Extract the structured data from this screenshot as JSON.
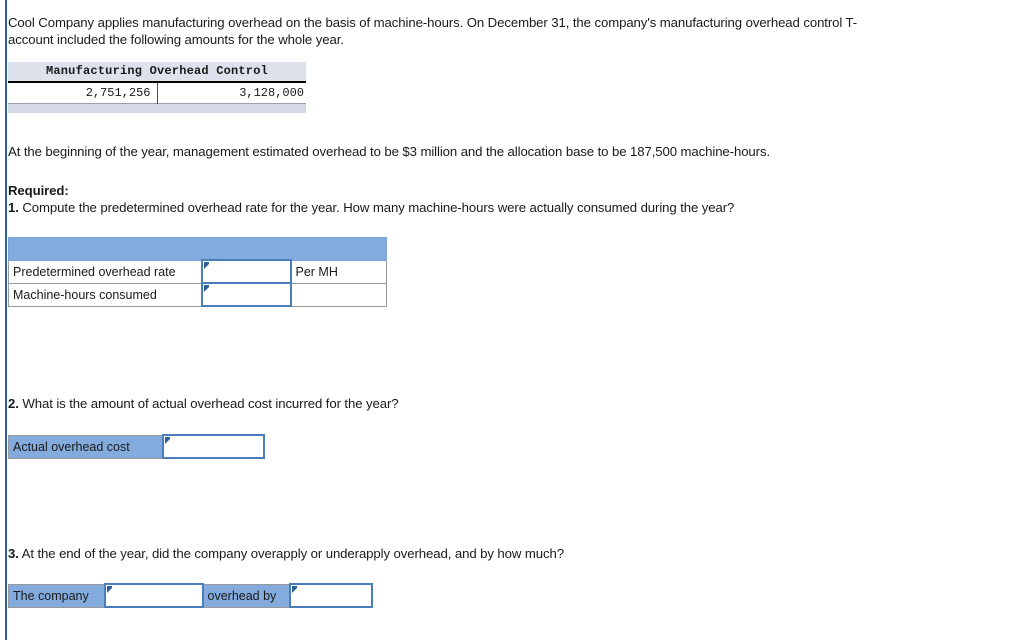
{
  "colors": {
    "left_rule": "#2f5fa8",
    "header_band": "#83abdd",
    "label_blue": "#83abdd",
    "input_border": "#4a7ebb",
    "input_marker": "#2d5f9e",
    "taccount_header_bg": "#dde1eb",
    "taccount_footer_bg": "#d6dae6"
  },
  "intro": {
    "paragraph": "Cool Company applies manufacturing overhead on the basis of machine-hours. On December 31, the company's manufacturing overhead control T-account included the following amounts for the whole year."
  },
  "taccount": {
    "title": "Manufacturing Overhead Control",
    "debit": "2,751,256",
    "credit": "3,128,000"
  },
  "estimate": {
    "paragraph": "At the beginning of the year, management estimated overhead to be $3 million and the allocation base to be 187,500 machine-hours."
  },
  "required": {
    "heading": "Required:"
  },
  "q1": {
    "number": "1.",
    "text": " Compute the predetermined overhead rate for the year. How many machine-hours were actually consumed during the year?",
    "rows": [
      {
        "label": "Predetermined overhead rate",
        "value": "",
        "unit": "Per MH"
      },
      {
        "label": "Machine-hours consumed",
        "value": "",
        "unit": ""
      }
    ]
  },
  "q2": {
    "number": "2.",
    "text": " What is the amount of actual overhead cost incurred for the year?",
    "row": {
      "label": "Actual overhead cost",
      "value": ""
    }
  },
  "q3": {
    "number": "3.",
    "text": " At the end of the year, did the company overapply or underapply overhead, and by how much?",
    "row": {
      "label_1": "The company",
      "value_1": "",
      "label_2": "overhead by",
      "value_2": ""
    }
  }
}
